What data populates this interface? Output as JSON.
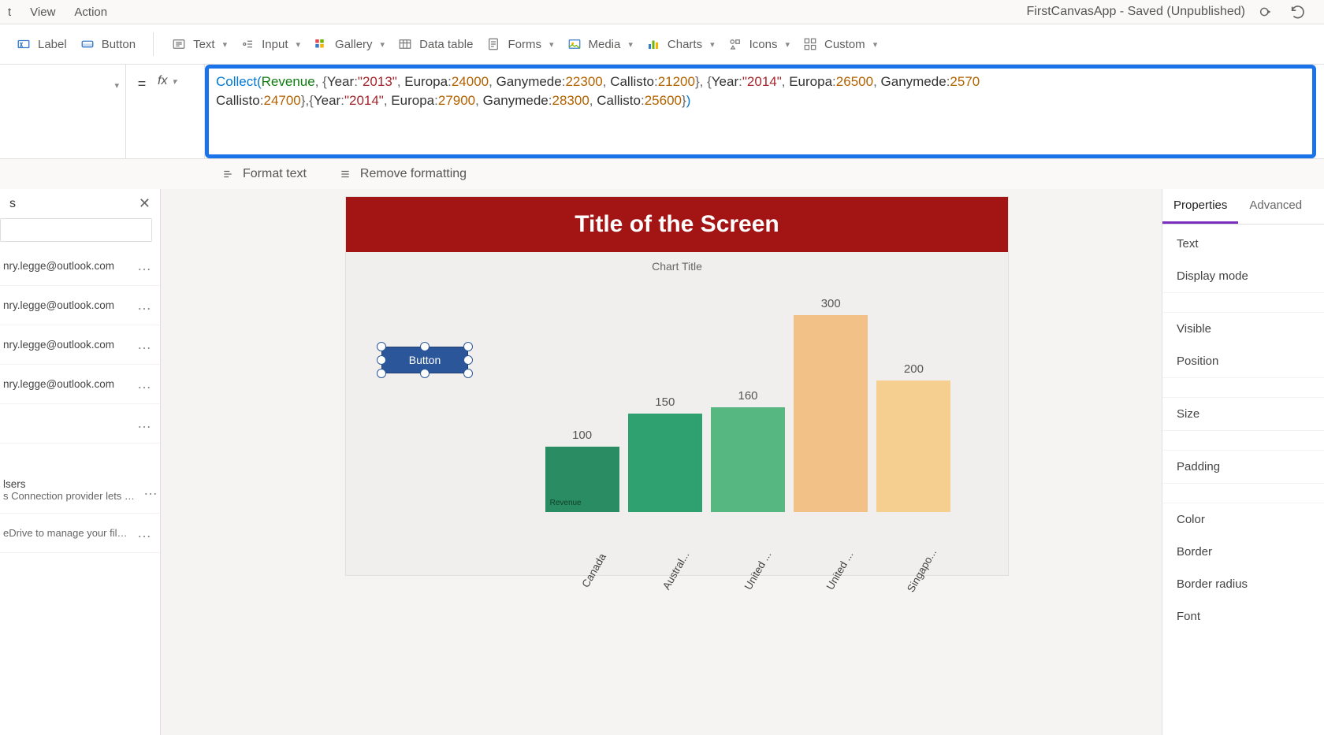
{
  "menu": {
    "items": [
      "t",
      "View",
      "Action"
    ]
  },
  "app_title": "FirstCanvasApp - Saved (Unpublished)",
  "ribbon": {
    "label_btn": "Label",
    "button_btn": "Button",
    "text_btn": "Text",
    "input_btn": "Input",
    "gallery_btn": "Gallery",
    "data_table_btn": "Data table",
    "forms_btn": "Forms",
    "media_btn": "Media",
    "charts_btn": "Charts",
    "icons_btn": "Icons",
    "custom_btn": "Custom"
  },
  "formula": {
    "raw": "Collect(Revenue, {Year:\"2013\", Europa:24000, Ganymede:22300, Callisto:21200}, {Year:\"2014\", Europa:26500, Ganymede:2570 Callisto:24700},{Year:\"2014\", Europa:27900, Ganymede:28300, Callisto:25600})",
    "tokens": [
      {
        "t": "Collect",
        "c": "fn"
      },
      {
        "t": "(",
        "c": "paren"
      },
      {
        "t": "Revenue",
        "c": "id"
      },
      {
        "t": ", {",
        "c": "punc"
      },
      {
        "t": "Year",
        "c": "key"
      },
      {
        "t": ":",
        "c": "punc"
      },
      {
        "t": "\"2013\"",
        "c": "str"
      },
      {
        "t": ", ",
        "c": "punc"
      },
      {
        "t": "Europa",
        "c": "key"
      },
      {
        "t": ":",
        "c": "punc"
      },
      {
        "t": "24000",
        "c": "num"
      },
      {
        "t": ", ",
        "c": "punc"
      },
      {
        "t": "Ganymede",
        "c": "key"
      },
      {
        "t": ":",
        "c": "punc"
      },
      {
        "t": "22300",
        "c": "num"
      },
      {
        "t": ", ",
        "c": "punc"
      },
      {
        "t": "Callisto",
        "c": "key"
      },
      {
        "t": ":",
        "c": "punc"
      },
      {
        "t": "21200",
        "c": "num"
      },
      {
        "t": "}, {",
        "c": "punc"
      },
      {
        "t": "Year",
        "c": "key"
      },
      {
        "t": ":",
        "c": "punc"
      },
      {
        "t": "\"2014\"",
        "c": "str"
      },
      {
        "t": ", ",
        "c": "punc"
      },
      {
        "t": "Europa",
        "c": "key"
      },
      {
        "t": ":",
        "c": "punc"
      },
      {
        "t": "26500",
        "c": "num"
      },
      {
        "t": ", ",
        "c": "punc"
      },
      {
        "t": "Ganymede",
        "c": "key"
      },
      {
        "t": ":",
        "c": "punc"
      },
      {
        "t": "2570",
        "c": "num"
      },
      {
        "t": "\n",
        "c": "punc"
      },
      {
        "t": "Callisto",
        "c": "key"
      },
      {
        "t": ":",
        "c": "punc"
      },
      {
        "t": "24700",
        "c": "num"
      },
      {
        "t": "},{",
        "c": "punc"
      },
      {
        "t": "Year",
        "c": "key"
      },
      {
        "t": ":",
        "c": "punc"
      },
      {
        "t": "\"2014\"",
        "c": "str"
      },
      {
        "t": ", ",
        "c": "punc"
      },
      {
        "t": "Europa",
        "c": "key"
      },
      {
        "t": ":",
        "c": "punc"
      },
      {
        "t": "27900",
        "c": "num"
      },
      {
        "t": ", ",
        "c": "punc"
      },
      {
        "t": "Ganymede",
        "c": "key"
      },
      {
        "t": ":",
        "c": "punc"
      },
      {
        "t": "28300",
        "c": "num"
      },
      {
        "t": ", ",
        "c": "punc"
      },
      {
        "t": "Callisto",
        "c": "key"
      },
      {
        "t": ":",
        "c": "punc"
      },
      {
        "t": "25600",
        "c": "num"
      },
      {
        "t": "}",
        "c": "punc"
      },
      {
        "t": ")",
        "c": "paren"
      }
    ]
  },
  "format_bar": {
    "format_text": "Format text",
    "remove_formatting": "Remove formatting"
  },
  "left_panel": {
    "title": "s",
    "connections": [
      {
        "email": "nry.legge@outlook.com"
      },
      {
        "email": "nry.legge@outlook.com"
      },
      {
        "email": "nry.legge@outlook.com"
      },
      {
        "email": "nry.legge@outlook.com"
      }
    ],
    "blank": {
      "email": ""
    },
    "users": {
      "title": "lsers",
      "desc": "s Connection provider lets you ..."
    },
    "onedrive": {
      "desc": "eDrive to manage your files. Yo..."
    }
  },
  "canvas": {
    "screen_title": "Title of the Screen",
    "selected_button_label": "Button",
    "chart_title": "Chart Title",
    "legend_label": "Revenue"
  },
  "chart_data": {
    "type": "bar",
    "title": "Chart Title",
    "categories": [
      "Canada",
      "Austral...",
      "United ...",
      "United ...",
      "Singapo..."
    ],
    "values": [
      100,
      150,
      160,
      300,
      200
    ],
    "series_name": "Revenue",
    "ylim": [
      0,
      300
    ],
    "colors": [
      "#2a8c62",
      "#2fa06f",
      "#56b781",
      "#f2c187",
      "#f5cf8f"
    ]
  },
  "right_panel": {
    "tabs": {
      "properties": "Properties",
      "advanced": "Advanced"
    },
    "items_a": [
      "Text",
      "Display mode"
    ],
    "items_b": [
      "Visible",
      "Position"
    ],
    "items_c": [
      "Size"
    ],
    "items_d": [
      "Padding"
    ],
    "items_e": [
      "Color",
      "Border",
      "Border radius",
      "Font"
    ]
  }
}
